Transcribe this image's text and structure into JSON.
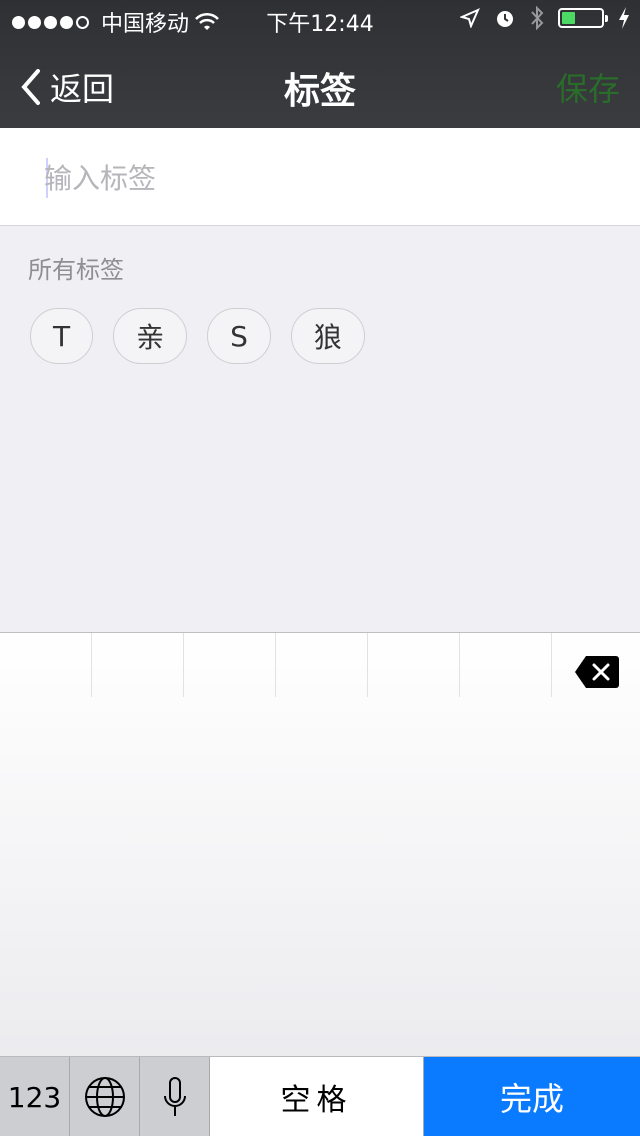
{
  "status": {
    "carrier": "中国移动",
    "time": "下午12:44",
    "battery_level": 0.3,
    "icons": [
      "signal-dots-icon",
      "wifi-icon",
      "location-icon",
      "alarm-icon",
      "bluetooth-icon",
      "battery-icon",
      "charging-icon"
    ]
  },
  "nav": {
    "back_label": "返回",
    "title": "标签",
    "save_label": "保存"
  },
  "input": {
    "placeholder": "输入标签",
    "value": ""
  },
  "section_label": "所有标签",
  "tags": [
    "T",
    "亲",
    "S",
    "狼"
  ],
  "keyboard": {
    "numbers_label": "123",
    "space_label": "空格",
    "done_label": "完成"
  },
  "colors": {
    "accent": "#0a7aff",
    "save_disabled": "#2a6c2a",
    "background": "#efeff4"
  }
}
